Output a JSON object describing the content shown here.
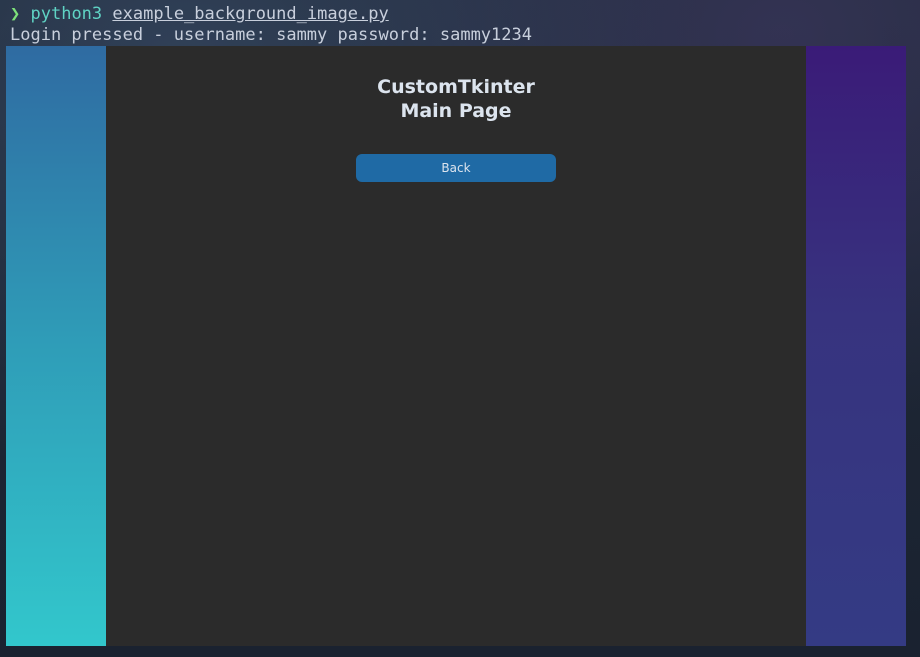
{
  "terminal": {
    "prompt_symbol": "❯",
    "command": "python3",
    "argument": "example_background_image.py",
    "output_line": "Login pressed - username: sammy password: sammy1234"
  },
  "app": {
    "title_line1": "CustomTkinter",
    "title_line2": "Main Page",
    "back_button_label": "Back"
  },
  "colors": {
    "frame_bg": "#2b2b2b",
    "button": "#1f6aa5",
    "text": "#dce4ee"
  }
}
